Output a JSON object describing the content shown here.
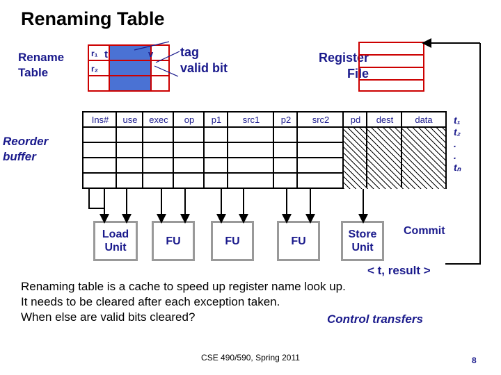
{
  "title": "Renaming Table",
  "labels": {
    "rename_table": "Rename\nTable",
    "reorder_buffer": "Reorder\nbuffer",
    "tag_valid": "tag\nvalid bit",
    "register_file": "Register\nFile",
    "commit": "Commit",
    "result": "< t, result >",
    "control_transfers": "Control transfers"
  },
  "rename_table": {
    "col_headers": [
      "t",
      "v"
    ],
    "rows": [
      "r₁",
      "r₂"
    ]
  },
  "reorder_buffer": {
    "columns": [
      "Ins#",
      "use",
      "exec",
      "op",
      "p1",
      "src1",
      "p2",
      "src2",
      "pd",
      "dest",
      "data"
    ],
    "row_count": 4
  },
  "tags": {
    "items": [
      "t₁",
      "t₂",
      ".",
      ".",
      "tₙ"
    ]
  },
  "units": [
    {
      "name": "load-unit",
      "label": "Load\nUnit"
    },
    {
      "name": "fu-1",
      "label": "FU"
    },
    {
      "name": "fu-2",
      "label": "FU"
    },
    {
      "name": "fu-3",
      "label": "FU"
    },
    {
      "name": "store-unit",
      "label": "Store\nUnit"
    }
  ],
  "body": {
    "line1": "Renaming table is a cache to speed up register name look up.",
    "line2": "It needs to be cleared after each exception taken.",
    "line3": "When else are valid bits cleared?"
  },
  "footer": {
    "course": "CSE 490/590, Spring 2011",
    "page": "8"
  },
  "colors": {
    "accent_blue": "#1a1a8c",
    "table_red": "#cc0000",
    "fill_blue": "#4a72d4",
    "gray_border": "#999999"
  }
}
